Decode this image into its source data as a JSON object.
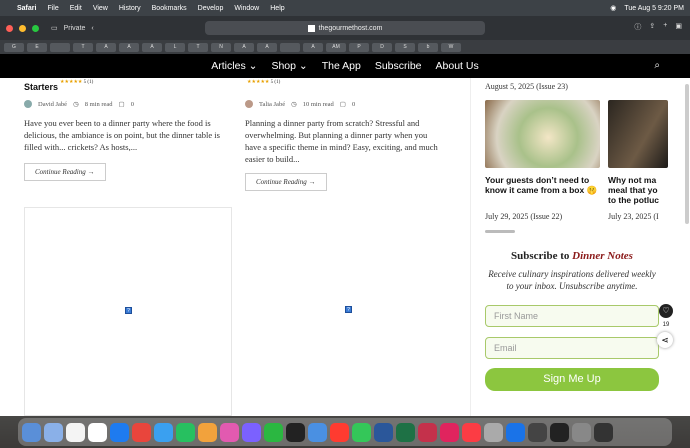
{
  "menubar": {
    "app": "Safari",
    "items": [
      "File",
      "Edit",
      "View",
      "History",
      "Bookmarks",
      "Develop",
      "Window",
      "Help"
    ],
    "clock": "Tue Aug 5  9:20 PM"
  },
  "browser": {
    "mode": "Private",
    "url": "thegourmethost.com",
    "bookmarks": [
      "G",
      "E",
      "",
      "T",
      "A",
      "A",
      "A",
      "L",
      "T",
      "N",
      "A",
      "A",
      "",
      "A",
      "AM",
      "P",
      "D",
      "S",
      "b",
      "W"
    ]
  },
  "site_nav": {
    "items": [
      {
        "label": "Articles",
        "dropdown": true
      },
      {
        "label": "Shop",
        "dropdown": true
      },
      {
        "label": "The App",
        "dropdown": false
      },
      {
        "label": "Subscribe",
        "dropdown": false
      },
      {
        "label": "About Us",
        "dropdown": false
      }
    ]
  },
  "posts": [
    {
      "title": "Starters",
      "rating": "5 (1)",
      "author": "David Jabé",
      "read_time": "8 min read",
      "comments": "0",
      "excerpt": "Have you ever been to a dinner party where the food is delicious, the ambiance is on point, but the dinner table is filled with... crickets? As hosts,...",
      "cta": "Continue Reading"
    },
    {
      "title": "",
      "rating": "5 (1)",
      "author": "Talia Jabé",
      "read_time": "10 min read",
      "comments": "0",
      "excerpt": "Planning a dinner party from scratch? Stressful and overwhelming.  But planning a dinner party when you have a specific theme in mind? Easy, exciting, and much easier to build...",
      "cta": "Continue Reading"
    }
  ],
  "sidebar": {
    "issue_date": "August 5, 2025 (Issue 23)",
    "cards": [
      {
        "title": "Your guests don’t need to know it came from a box 🤫",
        "date": "July 29, 2025 (Issue 22)"
      },
      {
        "title": "Why not ma meal that yo to the potluc",
        "date": "July 23, 2025 (I"
      }
    ],
    "subscribe_prefix": "Subscribe to",
    "subscribe_brand": "Dinner Notes",
    "subscribe_desc": "Receive culinary inspirations delivered weekly to your inbox. Unsubscribe anytime.",
    "first_name_placeholder": "First Name",
    "email_placeholder": "Email",
    "button": "Sign Me Up",
    "share_count": "19"
  },
  "colors": {
    "accent": "#8cc63f",
    "brand": "#8b1a1a"
  }
}
